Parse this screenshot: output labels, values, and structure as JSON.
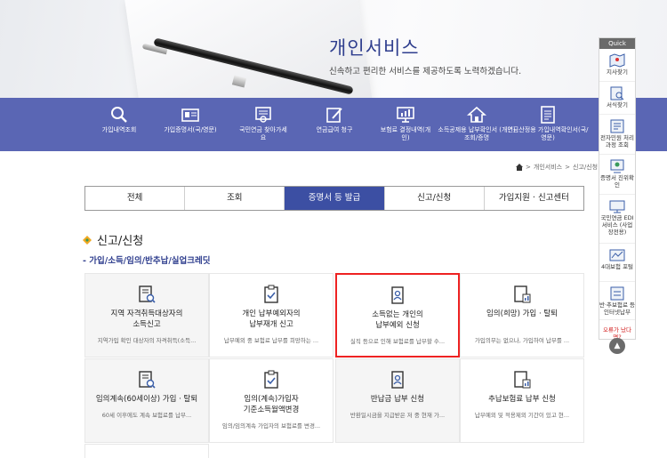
{
  "hero": {
    "title": "개인서비스",
    "subtitle": "신속하고 편리한 서비스를 제공하도록 노력하겠습니다."
  },
  "services": [
    {
      "label": "가입내역조회",
      "icon": "search-icon"
    },
    {
      "label": "가입증명서(국/영문)",
      "icon": "id-card-icon"
    },
    {
      "label": "국민연금 찾아가세요",
      "icon": "certificate-icon"
    },
    {
      "label": "연금급여 청구",
      "icon": "edit-document-icon"
    },
    {
      "label": "보험료 결정내역(개인)",
      "icon": "monitor-chart-icon"
    },
    {
      "label": "소득공제용 납부확인서 (개인)조회/증명",
      "icon": "house-icon"
    },
    {
      "label": "연금산정용 가입내역확인서(국/영문)",
      "icon": "document-icon"
    }
  ],
  "quick": {
    "header": "Quick",
    "items": [
      {
        "label": "지사찾기",
        "icon": "map-icon"
      },
      {
        "label": "서식찾기",
        "icon": "form-search-icon"
      },
      {
        "label": "전자민원 처리과정 조회",
        "icon": "process-icon"
      },
      {
        "label": "증명서 진위확인",
        "icon": "verify-icon"
      },
      {
        "label": "국민연금 EDI서비스 (사업장전용)",
        "icon": "edi-icon"
      },
      {
        "label": "4대보험 포털",
        "icon": "portal-icon"
      },
      {
        "label": "반·추보험료 등 인터넷납부",
        "icon": "payment-icon"
      },
      {
        "label": "오류가 났다면?",
        "icon": "error-icon"
      }
    ],
    "top_label": "▲"
  },
  "breadcrumb": [
    "개인서비스",
    "신고/신청"
  ],
  "tabs": [
    {
      "label": "전체",
      "active": false
    },
    {
      "label": "조회",
      "active": false
    },
    {
      "label": "증명서 등 발급",
      "active": true
    },
    {
      "label": "신고/신청",
      "active": false
    },
    {
      "label": "가입지원 · 신고센터",
      "active": false
    }
  ],
  "section": {
    "title": "신고/신청",
    "subtitle": "- 가입/소득/임의/반추납/실업크레딧"
  },
  "cards": [
    {
      "title1": "지역 자격취득대상자의",
      "title2": "소득신고",
      "desc": "지역가입 확인 대상자의 자격취득(소득...",
      "icon": "doc-search-icon"
    },
    {
      "title1": "개인 납부예외자의",
      "title2": "납부재개 신고",
      "desc": "납부예외 중 보험료 납부를 희망하는 ...",
      "icon": "clipboard-check-icon"
    },
    {
      "title1": "소득없는 개인의",
      "title2": "납부예외 신청",
      "desc": "실직 등으로 인해 보험료를 납부할 수...",
      "icon": "id-badge-icon"
    },
    {
      "title1": "임의(희망) 가입 · 탈퇴",
      "title2": "",
      "desc": "가입의무는 없으나, 가입하여 납부를 ...",
      "icon": "doc-chart-icon"
    },
    {
      "title1": "임의계속(60세이상) 가입 · 탈퇴",
      "title2": "",
      "desc": "60세 이후에도 계속 보험료를 납부...",
      "icon": "doc-search-icon"
    },
    {
      "title1": "임의(계속)가입자",
      "title2": "기준소득월액변경",
      "desc": "임의/임의계속 가입자의 보험료를 변경...",
      "icon": "clipboard-check-icon"
    },
    {
      "title1": "반납금 납부 신청",
      "title2": "",
      "desc": "반환일시금을 지급받은 저 중 현재 가...",
      "icon": "id-badge-icon"
    },
    {
      "title1": "추납보험료 납부 신청",
      "title2": "",
      "desc": "납부예외 및 적용제외 기간이 있고 현...",
      "icon": "doc-chart-icon"
    }
  ]
}
